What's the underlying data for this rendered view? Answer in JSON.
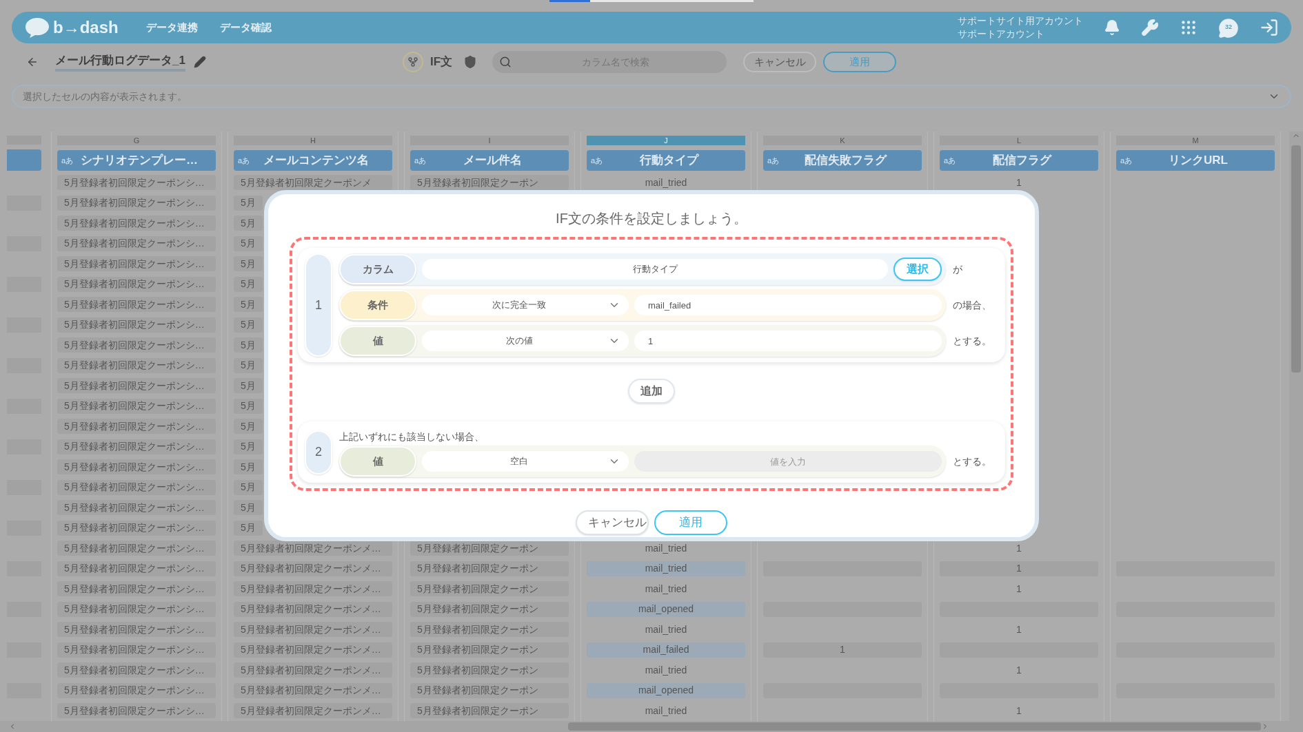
{
  "loading": {
    "level": 0.2
  },
  "top_bar": {
    "logo": "b→dash",
    "nav": [
      {
        "label": "データ連携"
      },
      {
        "label": "データ確認"
      }
    ],
    "account_lines": [
      "サポートサイト用アカウント",
      "サポートアカウント"
    ],
    "chat_badge": "32"
  },
  "toolbar": {
    "title": "メール行動ログデータ_1",
    "mode": "IF文",
    "search": {
      "placeholder": "カラム名で検索"
    },
    "buttons": [
      {
        "label": "キャンセル",
        "primary": false
      },
      {
        "label": "適用",
        "primary": true
      }
    ]
  },
  "cell_preview": {
    "placeholder": "選択したセルの内容が表示されます。"
  },
  "table": {
    "columns": [
      {
        "letter": "G",
        "name": "シナリオテンプレー…",
        "type": "aあ",
        "selected": false
      },
      {
        "letter": "H",
        "name": "メールコンテンツ名",
        "type": "aあ",
        "selected": false
      },
      {
        "letter": "I",
        "name": "メール件名",
        "type": "aあ",
        "selected": false
      },
      {
        "letter": "J",
        "name": "行動タイプ",
        "type": "aあ",
        "selected": true
      },
      {
        "letter": "K",
        "name": "配信失敗フラグ",
        "type": "aあ",
        "selected": false
      },
      {
        "letter": "L",
        "name": "配信フラグ",
        "type": "aあ",
        "selected": false
      },
      {
        "letter": "M",
        "name": "リンクURL",
        "type": "aあ",
        "selected": false
      }
    ],
    "rows": [
      {
        "cells": [
          "5月登録者初回限定クーポンシ…",
          "5月登録者初回限定クーポンメ",
          "5月登録者初回限定クーポン",
          "mail_tried",
          null,
          "1",
          null
        ]
      },
      {
        "cells": [
          "5月登録者初回限定クーポンシ…",
          "5月"
        ]
      },
      {
        "cells": [
          "5月登録者初回限定クーポンシ…",
          "5月"
        ]
      },
      {
        "cells": [
          "5月登録者初回限定クーポンシ…",
          "5月"
        ]
      },
      {
        "cells": [
          "5月登録者初回限定クーポンシ…",
          "5月"
        ]
      },
      {
        "cells": [
          "5月登録者初回限定クーポンシ…",
          "5月"
        ]
      },
      {
        "cells": [
          "5月登録者初回限定クーポンシ…",
          "5月"
        ]
      },
      {
        "cells": [
          "5月登録者初回限定クーポンシ…",
          "5月"
        ]
      },
      {
        "cells": [
          "5月登録者初回限定クーポンシ…",
          "5月"
        ]
      },
      {
        "cells": [
          "5月登録者初回限定クーポンシ…",
          "5月"
        ]
      },
      {
        "cells": [
          "5月登録者初回限定クーポンシ…",
          "5月"
        ]
      },
      {
        "cells": [
          "5月登録者初回限定クーポンシ…",
          "5月"
        ]
      },
      {
        "cells": [
          "5月登録者初回限定クーポンシ…",
          "5月"
        ]
      },
      {
        "cells": [
          "5月登録者初回限定クーポンシ…",
          "5月"
        ]
      },
      {
        "cells": [
          "5月登録者初回限定クーポンシ…",
          "5月"
        ]
      },
      {
        "cells": [
          "5月登録者初回限定クーポンシ…",
          "5月"
        ]
      },
      {
        "cells": [
          "5月登録者初回限定クーポンシ…",
          "5月"
        ]
      },
      {
        "cells": [
          "5月登録者初回限定クーポンシ…",
          "5月"
        ]
      },
      {
        "cells": [
          "5月登録者初回限定クーポンシ…",
          "5月登録者初回限定クーポンメ…",
          "5月登録者初回限定クーポン",
          "mail_tried",
          null,
          "1",
          null
        ]
      },
      {
        "cells": [
          "5月登録者初回限定クーポンシ…",
          "5月登録者初回限定クーポンメ…",
          "5月登録者初回限定クーポン",
          "mail_tried",
          null,
          "1",
          null
        ]
      },
      {
        "cells": [
          "5月登録者初回限定クーポンシ…",
          "5月登録者初回限定クーポンメ…",
          "5月登録者初回限定クーポン",
          "mail_tried",
          null,
          "1",
          null
        ]
      },
      {
        "cells": [
          "5月登録者初回限定クーポンシ…",
          "5月登録者初回限定クーポンメ…",
          "5月登録者初回限定クーポン",
          "mail_opened",
          null,
          null,
          null
        ]
      },
      {
        "cells": [
          "5月登録者初回限定クーポンシ…",
          "5月登録者初回限定クーポンメ…",
          "5月登録者初回限定クーポン",
          "mail_tried",
          null,
          "1",
          null
        ]
      },
      {
        "cells": [
          "5月登録者初回限定クーポンシ…",
          "5月登録者初回限定クーポンメ…",
          "5月登録者初回限定クーポン",
          "mail_failed",
          "1",
          null,
          null
        ]
      },
      {
        "cells": [
          "5月登録者初回限定クーポンシ…",
          "5月登録者初回限定クーポンメ…",
          "5月登録者初回限定クーポン",
          "mail_tried",
          null,
          "1",
          null
        ]
      },
      {
        "cells": [
          "5月登録者初回限定クーポンシ…",
          "5月登録者初回限定クーポンメ…",
          "5月登録者初回限定クーポン",
          "mail_opened",
          null,
          null,
          null
        ]
      },
      {
        "cells": [
          "5月登録者初回限定クーポンシ…",
          "5月登録者初回限定クーポンメ…",
          "5月登録者初回限定クーポン",
          "mail_tried",
          null,
          "1",
          null
        ]
      }
    ]
  },
  "dialog": {
    "title": "IF文の条件を設定しましょう。",
    "conditions": [
      {
        "number": "1",
        "rows": [
          {
            "kind": "column",
            "label": "カラム",
            "value": "行動タイプ",
            "button": "選択",
            "suffix": "が"
          },
          {
            "kind": "condition",
            "label": "条件",
            "select": "次に完全一致",
            "value": "mail_failed",
            "suffix": "の場合、"
          },
          {
            "kind": "value",
            "label": "値",
            "select": "次の値",
            "value": "1",
            "suffix": "とする。"
          }
        ]
      }
    ],
    "add_button": "追加",
    "fallback": {
      "number": "2",
      "note": "上記いずれにも該当しない場合、",
      "label": "値",
      "select": "空白",
      "placeholder": "値を入力",
      "disabled": true,
      "suffix": "とする。"
    },
    "buttons": [
      {
        "label": "キャンセル",
        "primary": false
      },
      {
        "label": "適用",
        "primary": true
      }
    ]
  }
}
